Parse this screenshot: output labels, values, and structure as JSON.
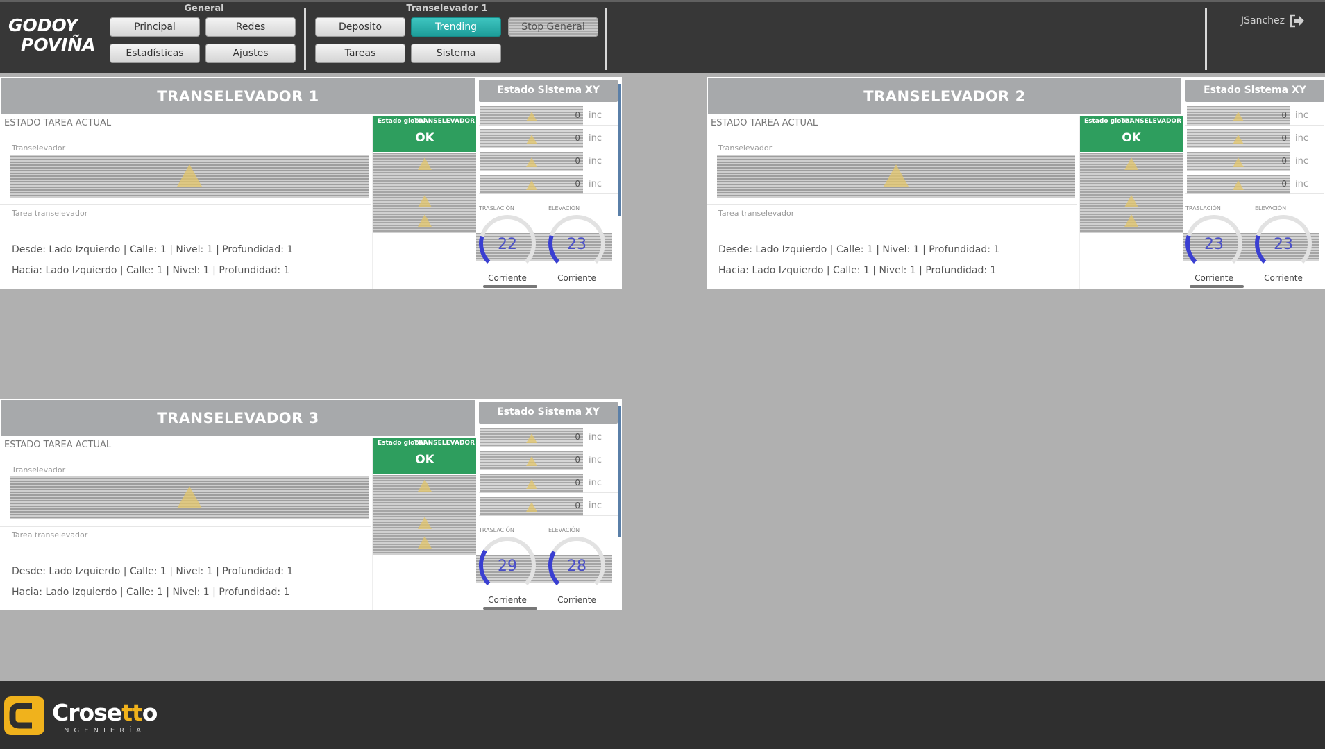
{
  "header": {
    "logo": {
      "line1": "GODOY",
      "line2": "POVIÑA"
    },
    "general_title": "General",
    "tv_title": "Transelevador 1",
    "buttons": {
      "principal": "Principal",
      "redes": "Redes",
      "estadisticas": "Estadísticas",
      "ajustes": "Ajustes",
      "deposito": "Deposito",
      "trending": "Trending",
      "stop_general": "Stop General",
      "tareas": "Tareas",
      "sistema": "Sistema"
    },
    "user": "JSanchez",
    "active_color": "#1d9d99"
  },
  "panels": [
    {
      "title": "TRANSELEVADOR 1",
      "estado_tarea": "ESTADO TAREA ACTUAL",
      "transelevador_label": "Transelevador",
      "tarea_label": "Tarea transelevador",
      "desde": "Desde: Lado Izquierdo | Calle: 1 | Nivel: 1 | Profundidad: 1",
      "hacia": "Hacia: Lado Izquierdo | Calle: 1 | Nivel: 1 | Profundidad: 1",
      "estado_global_label": "Estado global",
      "transelevador_tag": "TRANSELEVADOR",
      "status": "OK",
      "xy_title": "Estado Sistema XY",
      "xy_rows": [
        {
          "value": "0",
          "unit": "inc"
        },
        {
          "value": "0",
          "unit": "inc"
        },
        {
          "value": "0",
          "unit": "inc"
        },
        {
          "value": "0",
          "unit": "inc"
        }
      ],
      "traslacion_label": "TRASLACIÓN",
      "elevacion_label": "ELEVACIÓN",
      "traslacion_value": "22",
      "elevacion_value": "23",
      "traslacion_level": 0.22,
      "elevacion_level": 0.23,
      "corriente_a": "Corriente",
      "corriente_b": "Corriente"
    },
    {
      "title": "TRANSELEVADOR 2",
      "estado_tarea": "ESTADO TAREA ACTUAL",
      "transelevador_label": "Transelevador",
      "tarea_label": "Tarea transelevador",
      "desde": "Desde: Lado Izquierdo | Calle: 1 | Nivel: 1 | Profundidad: 1",
      "hacia": "Hacia: Lado Izquierdo | Calle: 1 | Nivel: 1 | Profundidad: 1",
      "estado_global_label": "Estado global",
      "transelevador_tag": "TRANSELEVADOR",
      "status": "OK",
      "xy_title": "Estado Sistema XY",
      "xy_rows": [
        {
          "value": "0",
          "unit": "inc"
        },
        {
          "value": "0",
          "unit": "inc"
        },
        {
          "value": "0",
          "unit": "inc"
        },
        {
          "value": "0",
          "unit": "inc"
        }
      ],
      "traslacion_label": "TRASLACIÓN",
      "elevacion_label": "ELEVACIÓN",
      "traslacion_value": "23",
      "elevacion_value": "23",
      "traslacion_level": 0.23,
      "elevacion_level": 0.23,
      "corriente_a": "Corriente",
      "corriente_b": "Corriente"
    },
    {
      "title": "TRANSELEVADOR 3",
      "estado_tarea": "ESTADO TAREA ACTUAL",
      "transelevador_label": "Transelevador",
      "tarea_label": "Tarea transelevador",
      "desde": "Desde: Lado Izquierdo | Calle: 1 | Nivel: 1 | Profundidad: 1",
      "hacia": "Hacia: Lado Izquierdo | Calle: 1 | Nivel: 1 | Profundidad: 1",
      "estado_global_label": "Estado global",
      "transelevador_tag": "TRANSELEVADOR",
      "status": "OK",
      "xy_title": "Estado Sistema XY",
      "xy_rows": [
        {
          "value": "0",
          "unit": "inc"
        },
        {
          "value": "0",
          "unit": "inc"
        },
        {
          "value": "0",
          "unit": "inc"
        },
        {
          "value": "0",
          "unit": "inc"
        }
      ],
      "traslacion_label": "TRASLACIÓN",
      "elevacion_label": "ELEVACIÓN",
      "traslacion_value": "29",
      "elevacion_value": "28",
      "traslacion_level": 0.29,
      "elevacion_level": 0.28,
      "corriente_a": "Corriente",
      "corriente_b": "Corriente"
    }
  ],
  "footer": {
    "brand_a": "Crose",
    "brand_b": "tt",
    "brand_c": "o",
    "brand_sub": "INGENIERÍA",
    "brand_color": "#f0b21c"
  },
  "colors": {
    "ok_green": "#2e9e5e",
    "gauge_blue": "#3a3fd1",
    "panel_title_bg": "#a7a9ab"
  }
}
